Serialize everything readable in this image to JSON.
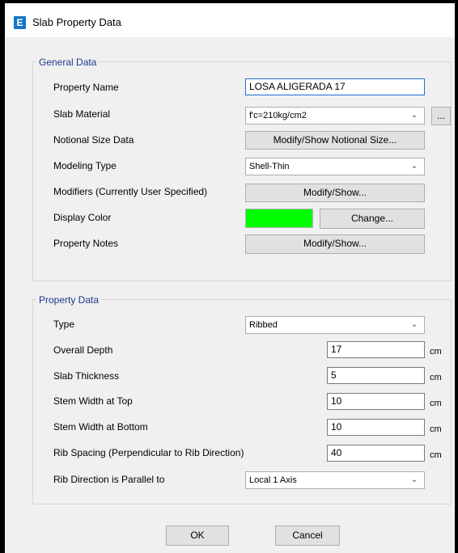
{
  "window": {
    "title": "Slab Property Data",
    "icon_letter": "E"
  },
  "general": {
    "legend": "General Data",
    "property_name_label": "Property Name",
    "property_name_value": "LOSA ALIGERADA 17",
    "slab_material_label": "Slab Material",
    "slab_material_value": "f'c=210kg/cm2",
    "ellipsis_label": "...",
    "notional_label": "Notional Size Data",
    "notional_button": "Modify/Show Notional Size...",
    "modeling_label": "Modeling Type",
    "modeling_value": "Shell-Thin",
    "modifiers_label": "Modifiers (Currently User Specified)",
    "modifiers_button": "Modify/Show...",
    "display_color_label": "Display Color",
    "display_color_value": "#00ff00",
    "change_button": "Change...",
    "notes_label": "Property Notes",
    "notes_button": "Modify/Show..."
  },
  "property": {
    "legend": "Property Data",
    "type_label": "Type",
    "type_value": "Ribbed",
    "overall_depth_label": "Overall Depth",
    "overall_depth_value": "17",
    "slab_thickness_label": "Slab Thickness",
    "slab_thickness_value": "5",
    "stem_top_label": "Stem Width at Top",
    "stem_top_value": "10",
    "stem_bottom_label": "Stem Width at Bottom",
    "stem_bottom_value": "10",
    "rib_spacing_label": "Rib Spacing (Perpendicular to Rib Direction)",
    "rib_spacing_value": "40",
    "unit": "cm",
    "rib_direction_label": "Rib Direction is Parallel to",
    "rib_direction_value": "Local 1 Axis"
  },
  "footer": {
    "ok": "OK",
    "cancel": "Cancel"
  },
  "icons": {
    "dropdown": "chevron-down-icon",
    "app": "app-icon"
  }
}
